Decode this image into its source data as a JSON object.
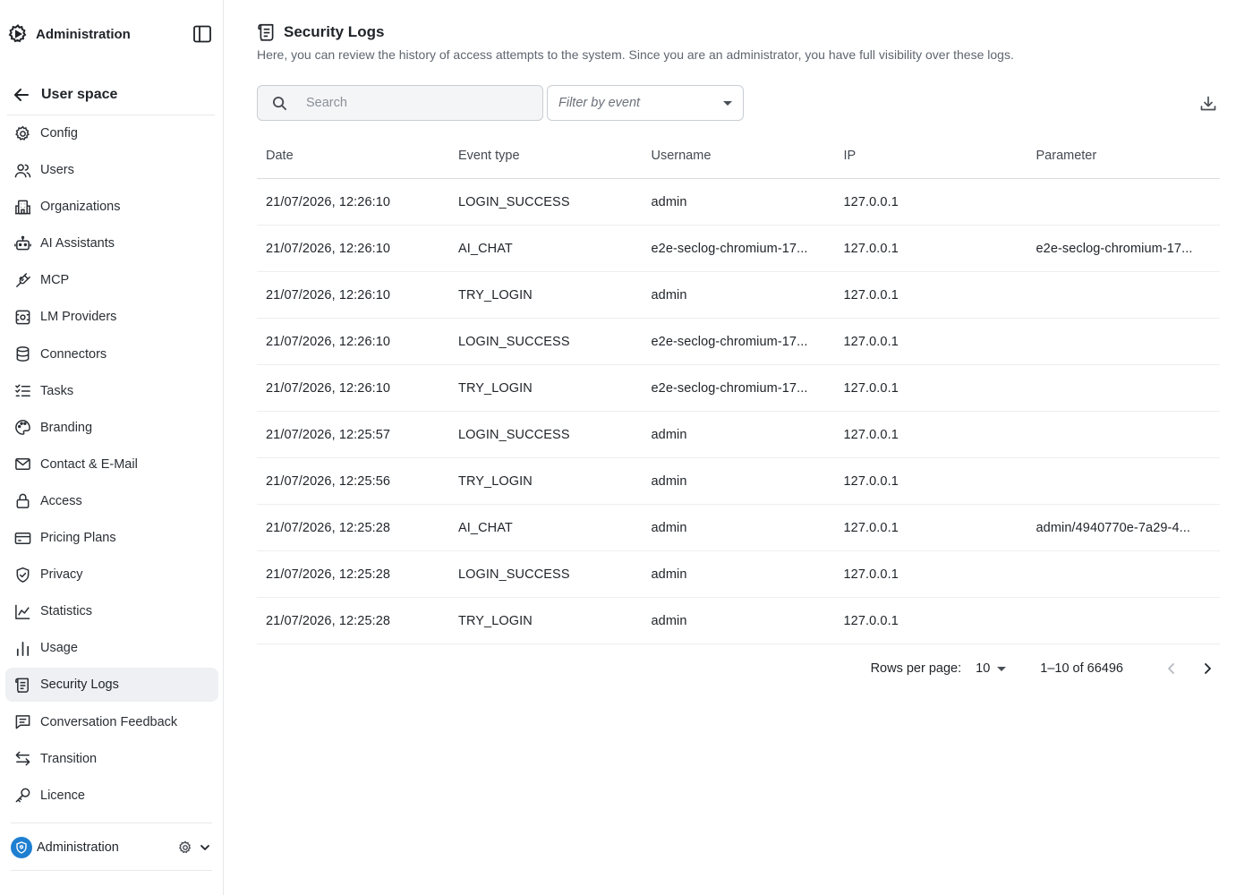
{
  "sidebar": {
    "app_title": "Administration",
    "back_label": "User space",
    "items": [
      {
        "label": "Config",
        "icon": "gear-icon"
      },
      {
        "label": "Users",
        "icon": "users-icon"
      },
      {
        "label": "Organizations",
        "icon": "building-icon"
      },
      {
        "label": "AI Assistants",
        "icon": "robot-icon"
      },
      {
        "label": "MCP",
        "icon": "plug-icon"
      },
      {
        "label": "LM Providers",
        "icon": "provider-icon"
      },
      {
        "label": "Connectors",
        "icon": "database-icon"
      },
      {
        "label": "Tasks",
        "icon": "checklist-icon"
      },
      {
        "label": "Branding",
        "icon": "palette-icon"
      },
      {
        "label": "Contact & E-Mail",
        "icon": "mail-icon"
      },
      {
        "label": "Access",
        "icon": "lock-icon"
      },
      {
        "label": "Pricing Plans",
        "icon": "credit-card-icon"
      },
      {
        "label": "Privacy",
        "icon": "shield-check-icon"
      },
      {
        "label": "Statistics",
        "icon": "chart-line-icon"
      },
      {
        "label": "Usage",
        "icon": "bar-chart-icon"
      },
      {
        "label": "Security Logs",
        "icon": "scroll-icon"
      },
      {
        "label": "Conversation Feedback",
        "icon": "message-square-icon"
      },
      {
        "label": "Transition",
        "icon": "arrows-swap-icon"
      },
      {
        "label": "Licence",
        "icon": "key-icon"
      }
    ],
    "active_index": 15,
    "footer": {
      "org_name": "Administration"
    }
  },
  "page": {
    "title": "Security Logs",
    "description": "Here, you can review the history of access attempts to the system. Since you are an administrator, you have full visibility over these logs."
  },
  "search": {
    "placeholder": "Search"
  },
  "filter": {
    "placeholder": "Filter by event"
  },
  "table": {
    "columns": [
      "Date",
      "Event type",
      "Username",
      "IP",
      "Parameter"
    ],
    "rows": [
      [
        "21/07/2026, 12:26:10",
        "LOGIN_SUCCESS",
        "admin",
        "127.0.0.1",
        ""
      ],
      [
        "21/07/2026, 12:26:10",
        "AI_CHAT",
        "e2e-seclog-chromium-17...",
        "127.0.0.1",
        "e2e-seclog-chromium-17..."
      ],
      [
        "21/07/2026, 12:26:10",
        "TRY_LOGIN",
        "admin",
        "127.0.0.1",
        ""
      ],
      [
        "21/07/2026, 12:26:10",
        "LOGIN_SUCCESS",
        "e2e-seclog-chromium-17...",
        "127.0.0.1",
        ""
      ],
      [
        "21/07/2026, 12:26:10",
        "TRY_LOGIN",
        "e2e-seclog-chromium-17...",
        "127.0.0.1",
        ""
      ],
      [
        "21/07/2026, 12:25:57",
        "LOGIN_SUCCESS",
        "admin",
        "127.0.0.1",
        ""
      ],
      [
        "21/07/2026, 12:25:56",
        "TRY_LOGIN",
        "admin",
        "127.0.0.1",
        ""
      ],
      [
        "21/07/2026, 12:25:28",
        "AI_CHAT",
        "admin",
        "127.0.0.1",
        "admin/4940770e-7a29-4..."
      ],
      [
        "21/07/2026, 12:25:28",
        "LOGIN_SUCCESS",
        "admin",
        "127.0.0.1",
        ""
      ],
      [
        "21/07/2026, 12:25:28",
        "TRY_LOGIN",
        "admin",
        "127.0.0.1",
        ""
      ]
    ]
  },
  "pagination": {
    "rows_per_page_label": "Rows per page:",
    "rows_per_page": "10",
    "range": "1–10 of 66496"
  },
  "colors": {
    "accent": "#1f7fd1",
    "active_bg": "#eef0f3"
  }
}
